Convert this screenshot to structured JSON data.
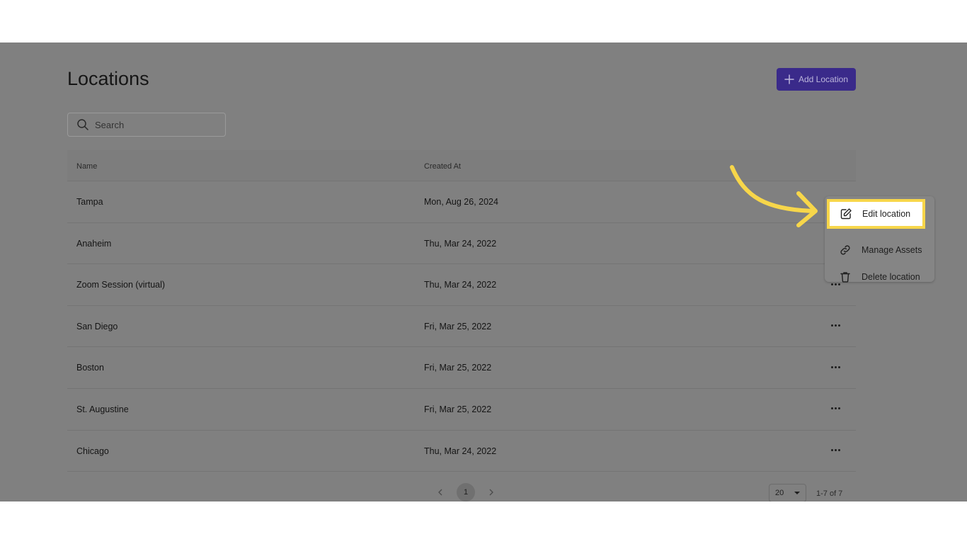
{
  "page": {
    "title": "Locations",
    "add_button_label": "Add Location",
    "search_placeholder": "Search"
  },
  "table": {
    "columns": [
      "Name",
      "Created At"
    ],
    "rows": [
      {
        "name": "Tampa",
        "created_at": "Mon, Aug 26, 2024"
      },
      {
        "name": "Anaheim",
        "created_at": "Thu, Mar 24, 2022"
      },
      {
        "name": "Zoom Session (virtual)",
        "created_at": "Thu, Mar 24, 2022"
      },
      {
        "name": "San Diego",
        "created_at": "Fri, Mar 25, 2022"
      },
      {
        "name": "Boston",
        "created_at": "Fri, Mar 25, 2022"
      },
      {
        "name": "St. Augustine",
        "created_at": "Fri, Mar 25, 2022"
      },
      {
        "name": "Chicago",
        "created_at": "Thu, Mar 24, 2022"
      }
    ]
  },
  "pagination": {
    "current_page": "1",
    "per_page": "20",
    "range_text": "1-7 of 7"
  },
  "context_menu": {
    "items": [
      {
        "label": "Edit location",
        "icon": "edit-icon",
        "highlighted": true
      },
      {
        "label": "Manage Assets",
        "icon": "link-icon"
      },
      {
        "label": "Delete location",
        "icon": "trash-icon"
      }
    ]
  },
  "colors": {
    "accent": "#3a2a8a",
    "highlight": "#f7d64a",
    "overlay": "#808080"
  }
}
